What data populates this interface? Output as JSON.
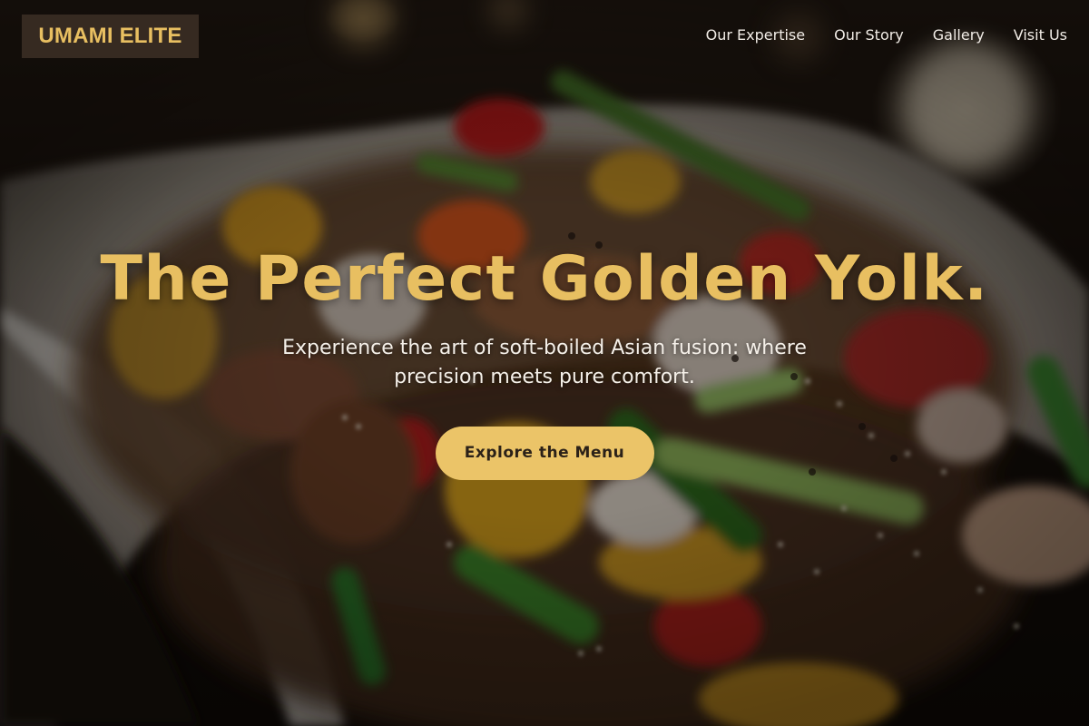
{
  "nav": {
    "brand": "UMAMI ELITE",
    "links": [
      {
        "label": "Our Expertise"
      },
      {
        "label": "Our Story"
      },
      {
        "label": "Gallery"
      },
      {
        "label": "Visit Us"
      }
    ]
  },
  "hero": {
    "headline": "The Perfect Golden Yolk.",
    "subtitle": "Experience the art of soft-boiled Asian fusion: where precision meets pure comfort.",
    "cta_label": "Explore the Menu",
    "background_image": "blurred close-up of an Asian stir-fry dish with peppers, meat, green onions and sesame in a white bowl"
  },
  "colors": {
    "accent": "#e8bf61",
    "button": "#ebc468",
    "button_text": "#2b2118",
    "nav_text": "#f1ece6",
    "logo_bg": "#3a2c24"
  }
}
